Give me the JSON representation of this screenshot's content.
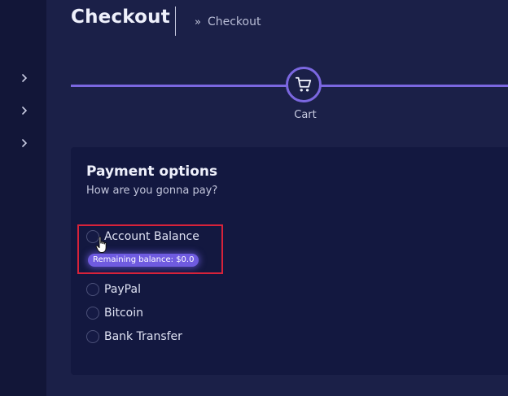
{
  "header": {
    "title": "Checkout",
    "breadcrumb_separator": "»",
    "breadcrumb_current": "Checkout"
  },
  "sidebar": {
    "items": [
      {
        "icon": "chevron-right-icon"
      },
      {
        "icon": "chevron-right-icon"
      },
      {
        "icon": "chevron-right-icon"
      }
    ]
  },
  "stepper": {
    "steps": [
      {
        "label": "Cart",
        "icon": "cart-icon",
        "active": true
      }
    ]
  },
  "payment": {
    "title": "Payment options",
    "subtitle": "How are you gonna pay?",
    "options": [
      {
        "label": "Account Balance",
        "selected": false
      },
      {
        "label": "PayPal",
        "selected": false
      },
      {
        "label": "Bitcoin",
        "selected": false
      },
      {
        "label": "Bank Transfer",
        "selected": false
      }
    ],
    "balance_badge": "Remaining balance: $0.0"
  },
  "colors": {
    "accent": "#7b67e0",
    "highlight_box": "#d7223a",
    "background": "#1b2048",
    "sidebar": "#121638",
    "card": "#131840"
  }
}
